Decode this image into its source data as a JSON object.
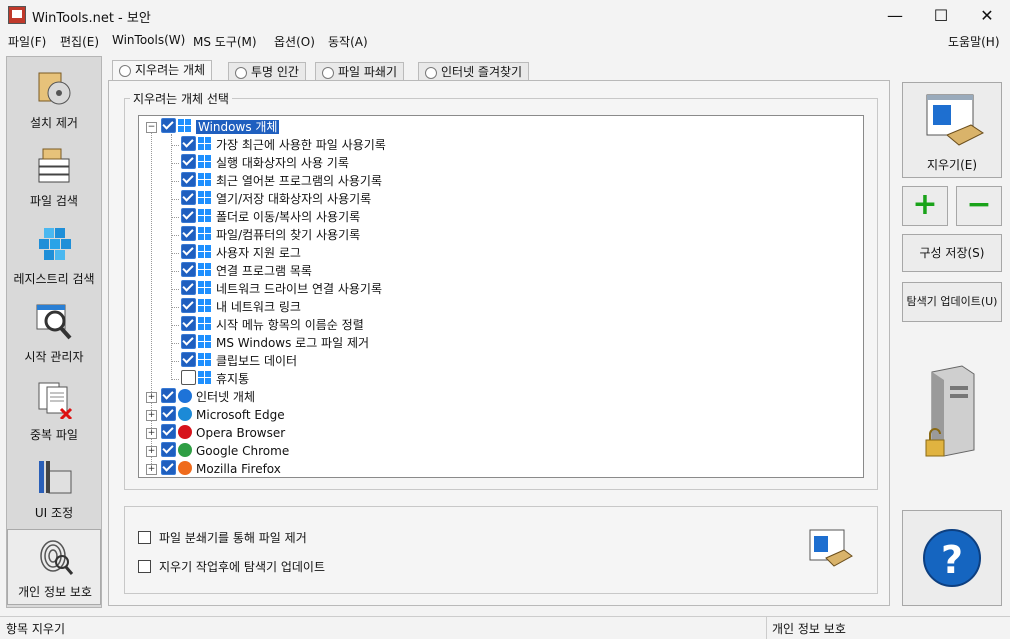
{
  "window": {
    "title": "WinTools.net - 보안",
    "minimize": "—",
    "maximize": "☐",
    "close": "✕"
  },
  "menu": {
    "items": [
      "파일(F)",
      "편집(E)",
      "WinTools(W)",
      "MS 도구(M)",
      "옵션(O)",
      "동작(A)"
    ],
    "help": "도움말(H)"
  },
  "sidebar": {
    "items": [
      {
        "label": "설치 제거",
        "icon": "disc-box-icon"
      },
      {
        "label": "파일 검색",
        "icon": "file-stack-icon"
      },
      {
        "label": "레지스트리 검색",
        "icon": "registry-cubes-icon"
      },
      {
        "label": "시작 관리자",
        "icon": "magnifier-window-icon"
      },
      {
        "label": "중복 파일",
        "icon": "duplicate-doc-icon"
      },
      {
        "label": "UI 조정",
        "icon": "tools-icon"
      },
      {
        "label": "개인 정보 보호",
        "icon": "fingerprint-icon"
      }
    ]
  },
  "tabs": [
    "지우려는 개체",
    "투명 인간",
    "파일 파쇄기",
    "인터넷 즐겨찾기"
  ],
  "group_label": "지우려는 개체 선택",
  "tree": {
    "root": {
      "label": "Windows 개체",
      "checked": true,
      "selected": true
    },
    "windows_items": [
      {
        "label": "가장 최근에 사용한 파일 사용기록",
        "checked": true
      },
      {
        "label": "실행 대화상자의 사용 기록",
        "checked": true
      },
      {
        "label": "최근 열어본 프로그램의 사용기록",
        "checked": true
      },
      {
        "label": "열기/저장 대화상자의 사용기록",
        "checked": true
      },
      {
        "label": "폴더로 이동/복사의 사용기록",
        "checked": true
      },
      {
        "label": "파일/컴퓨터의 찾기 사용기록",
        "checked": true
      },
      {
        "label": "사용자 지원 로그",
        "checked": true
      },
      {
        "label": "연결 프로그램 목록",
        "checked": true
      },
      {
        "label": "네트워크 드라이브 연결 사용기록",
        "checked": true
      },
      {
        "label": "내 네트워크 링크",
        "checked": true
      },
      {
        "label": "시작 메뉴 항목의 이름순 정렬",
        "checked": true
      },
      {
        "label": "MS Windows 로그 파일 제거",
        "checked": true
      },
      {
        "label": "클립보드 데이터",
        "checked": true
      },
      {
        "label": "휴지통",
        "checked": false
      }
    ],
    "browsers": [
      {
        "label": "인터넷 개체",
        "icon": "ie-icon",
        "color": "#1e73d8"
      },
      {
        "label": "Microsoft Edge",
        "icon": "edge-icon",
        "color": "#1c8ad7"
      },
      {
        "label": "Opera Browser",
        "icon": "opera-icon",
        "color": "#d7131b"
      },
      {
        "label": "Google Chrome",
        "icon": "chrome-icon",
        "color": "#2f9e44"
      },
      {
        "label": "Mozilla Firefox",
        "icon": "firefox-icon",
        "color": "#ef6a1b"
      }
    ]
  },
  "options": [
    {
      "label": "파일 분쇄기를 통해 파일 제거",
      "checked": false
    },
    {
      "label": "지우기 작업후에 탐색기 업데이트",
      "checked": false
    }
  ],
  "right_panel": {
    "erase_button": "지우기(E)",
    "add_button": "+",
    "remove_button": "−",
    "save_config_button": "구성 저장(S)",
    "explorer_update_button": "탐색기 업데이트(U)",
    "help_button": "?"
  },
  "status": {
    "left": "항목 지우기",
    "right": "개인 정보 보호"
  },
  "colors": {
    "accent": "#1f5fbf",
    "win_logo": "#1e90ff",
    "help_blue": "#1565c0",
    "plus_green": "#1aa31a"
  }
}
